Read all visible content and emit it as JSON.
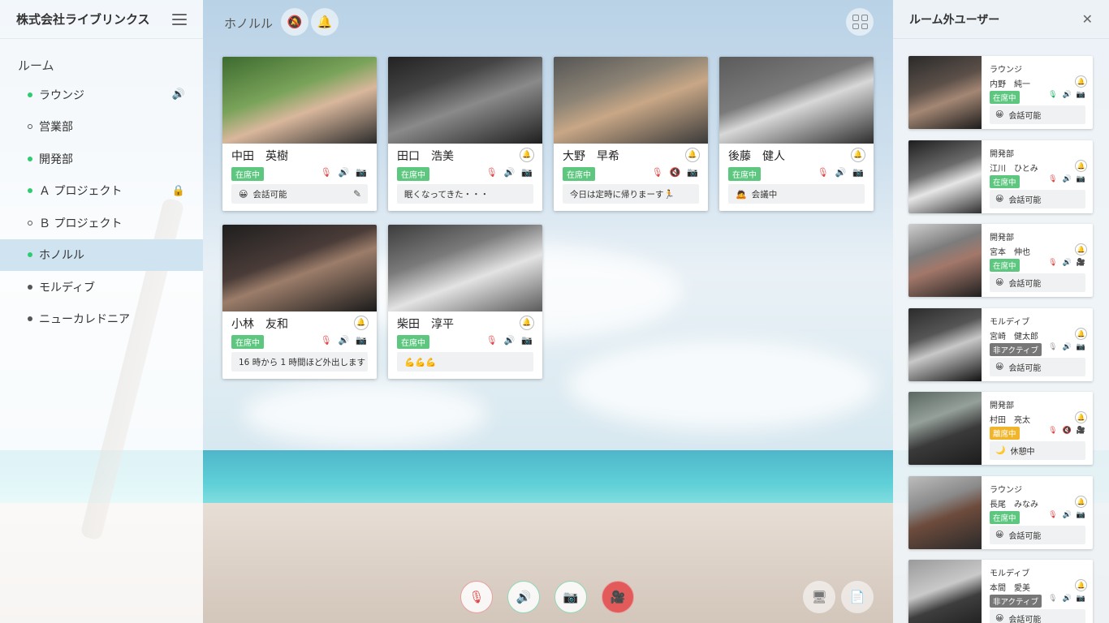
{
  "sidebar": {
    "company": "株式会社ライブリンクス",
    "rooms_title": "ルーム",
    "rooms": [
      {
        "label": "ラウンジ",
        "dot": "on",
        "icon": "🔊"
      },
      {
        "label": "営業部",
        "dot": "off",
        "icon": ""
      },
      {
        "label": "開発部",
        "dot": "on",
        "icon": ""
      },
      {
        "label": "Ａ プロジェクト",
        "dot": "on",
        "icon": "🔒"
      },
      {
        "label": "Ｂ プロジェクト",
        "dot": "off",
        "icon": ""
      },
      {
        "label": "ホノルル",
        "dot": "on",
        "icon": "",
        "active": true
      },
      {
        "label": "モルディブ",
        "dot": "dark",
        "icon": ""
      },
      {
        "label": "ニューカレドニア",
        "dot": "dark",
        "icon": ""
      }
    ]
  },
  "main": {
    "room_name": "ホノルル",
    "members": [
      {
        "name": "中田　英樹",
        "status": "在席中",
        "message": "会話可能",
        "emoji": "😀",
        "editable": true
      },
      {
        "name": "田口　浩美",
        "status": "在席中",
        "message": "眠くなってきた・・・",
        "emoji": ""
      },
      {
        "name": "大野　早希",
        "status": "在席中",
        "message": "今日は定時に帰りまーす🏃",
        "emoji": ""
      },
      {
        "name": "後藤　健人",
        "status": "在席中",
        "message": "会議中",
        "emoji": "🙇"
      },
      {
        "name": "小林　友和",
        "status": "在席中",
        "message": "16 時から 1 時間ほど外出します",
        "emoji": ""
      },
      {
        "name": "柴田　淳平",
        "status": "在席中",
        "message": "💪💪💪",
        "emoji": ""
      }
    ]
  },
  "right_panel": {
    "title": "ルーム外ユーザー",
    "users": [
      {
        "room": "ラウンジ",
        "name": "内野　純一",
        "status": "在席中",
        "status_type": "on",
        "message": "会話可能",
        "emoji": "😀"
      },
      {
        "room": "開発部",
        "name": "江川　ひとみ",
        "status": "在席中",
        "status_type": "on",
        "message": "会話可能",
        "emoji": "😀"
      },
      {
        "room": "開発部",
        "name": "宮本　伸也",
        "status": "在席中",
        "status_type": "on",
        "message": "会話可能",
        "emoji": "😀"
      },
      {
        "room": "モルディブ",
        "name": "宮崎　健太郎",
        "status": "非アクティブ",
        "status_type": "inactive",
        "message": "会話可能",
        "emoji": "😀"
      },
      {
        "room": "開発部",
        "name": "村田　亮太",
        "status": "離席中",
        "status_type": "away",
        "message": "休憩中",
        "emoji": "🌙"
      },
      {
        "room": "ラウンジ",
        "name": "長尾　みなみ",
        "status": "在席中",
        "status_type": "on",
        "message": "会話可能",
        "emoji": "😀"
      },
      {
        "room": "モルディブ",
        "name": "本間　愛美",
        "status": "非アクティブ",
        "status_type": "inactive",
        "message": "会話可能",
        "emoji": "😀"
      }
    ]
  },
  "icons": {
    "mic_off": "mic-off-icon",
    "speaker": "speaker-icon",
    "camera": "camera-icon",
    "bell": "bell-icon",
    "video_off": "video-off-icon"
  },
  "colors": {
    "present": "#5ec77f",
    "inactive": "#777777",
    "away": "#f0b52b",
    "mute_red": "#e04848",
    "active_green": "#1fb36b"
  }
}
